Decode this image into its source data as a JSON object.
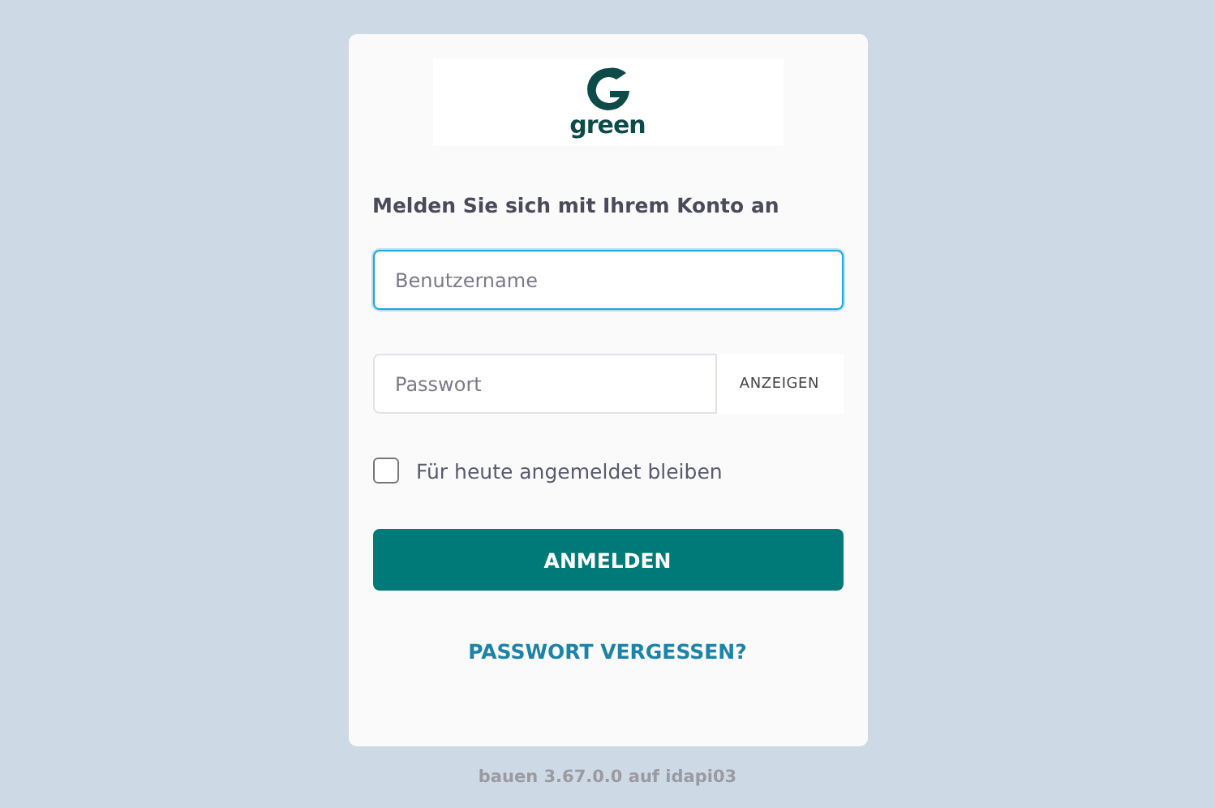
{
  "logo": {
    "wordmark": "green"
  },
  "heading": "Melden Sie sich mit Ihrem Konto an",
  "username": {
    "placeholder": "Benutzername",
    "focused": true
  },
  "password": {
    "placeholder": "Passwort",
    "focused": false,
    "toggle": "ANZEIGEN"
  },
  "remember": {
    "label": "Für heute angemeldet bleiben",
    "checked": false
  },
  "submit": "ANMELDEN",
  "forgot_link": "PASSWORT VERGESSEN?",
  "footer": "bauen 3.67.0.0 auf idapi03"
}
